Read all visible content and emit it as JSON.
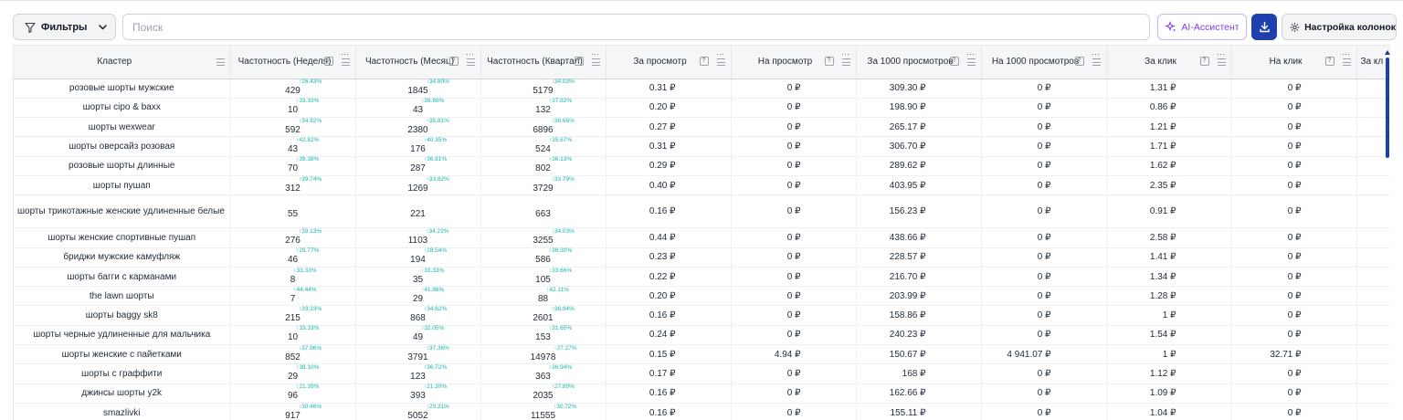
{
  "toolbar": {
    "filters_label": "Фильтры",
    "search_placeholder": "Поиск",
    "ai_label": "AI-Ассистент",
    "columns_label": "Настройка колонок"
  },
  "table": {
    "headers": {
      "cluster": "Кластер",
      "freq_week": "Частотность (Неделя)",
      "freq_month": "Частотность (Месяц)",
      "freq_quarter": "Частотность (Квартал)",
      "per_view": "За просмотр",
      "on_view": "На просмотр",
      "per_1000": "За 1000 просмотров",
      "on_1000": "На 1000 просмотров",
      "per_click": "За клик",
      "on_click": "На клик",
      "per_extra": "За кл"
    },
    "rows": [
      {
        "kw": "розовые шорты мужские",
        "w": "429",
        "wp": "↑26.43%",
        "m": "1845",
        "mp": "↑34.80%",
        "q": "5179",
        "qp": "↑34.03%",
        "pv": "0.31 ₽",
        "ov": "0 ₽",
        "p1k": "309.30 ₽",
        "o1k": "0 ₽",
        "pc": "1.31 ₽",
        "oc": "0 ₽"
      },
      {
        "kw": "шорты cipo & baxx",
        "w": "10",
        "wp": "↑33.33%",
        "m": "43",
        "mp": "↑39.88%",
        "q": "132",
        "qp": "↑37.82%",
        "pv": "0.20 ₽",
        "ov": "0 ₽",
        "p1k": "198.90 ₽",
        "o1k": "0 ₽",
        "pc": "0.86 ₽",
        "oc": "0 ₽"
      },
      {
        "kw": "шорты wexwear",
        "w": "592",
        "wp": "↑34.92%",
        "m": "2380",
        "mp": "↑35.81%",
        "q": "6896",
        "qp": "↑36.65%",
        "pv": "0.27 ₽",
        "ov": "0 ₽",
        "p1k": "265.17 ₽",
        "o1k": "0 ₽",
        "pc": "1.21 ₽",
        "oc": "0 ₽"
      },
      {
        "kw": "шорты оверсайз розовая",
        "w": "43",
        "wp": "↑42.82%",
        "m": "176",
        "mp": "↑40.35%",
        "q": "524",
        "qp": "↑35.67%",
        "pv": "0.31 ₽",
        "ov": "0 ₽",
        "p1k": "306.70 ₽",
        "o1k": "0 ₽",
        "pc": "1.71 ₽",
        "oc": "0 ₽"
      },
      {
        "kw": "розовые шорты длинные",
        "w": "70",
        "wp": "↑39.38%",
        "m": "287",
        "mp": "↑36.81%",
        "q": "802",
        "qp": "↑36.13%",
        "pv": "0.29 ₽",
        "ov": "0 ₽",
        "p1k": "289.62 ₽",
        "o1k": "0 ₽",
        "pc": "1.62 ₽",
        "oc": "0 ₽"
      },
      {
        "kw": "шорты пушап",
        "w": "312",
        "wp": "↑39.74%",
        "m": "1269",
        "mp": "↑33.82%",
        "q": "3729",
        "qp": "↑33.79%",
        "pv": "0.40 ₽",
        "ov": "0 ₽",
        "p1k": "403.95 ₽",
        "o1k": "0 ₽",
        "pc": "2.35 ₽",
        "oc": "0 ₽"
      },
      {
        "kw": "шорты трикотажные женские удлиненные белые",
        "w": "55",
        "wp": "",
        "m": "221",
        "mp": "",
        "q": "663",
        "qp": "",
        "pv": "0.16 ₽",
        "ov": "0 ₽",
        "p1k": "156.23 ₽",
        "o1k": "0 ₽",
        "pc": "0.91 ₽",
        "oc": "0 ₽",
        "tall": true
      },
      {
        "kw": "шорты женские спортивные пушап",
        "w": "276",
        "wp": "↑39.13%",
        "m": "1103",
        "mp": "↑34.23%",
        "q": "3255",
        "qp": "↑34.03%",
        "pv": "0.44 ₽",
        "ov": "0 ₽",
        "p1k": "438.66 ₽",
        "o1k": "0 ₽",
        "pc": "2.58 ₽",
        "oc": "0 ₽"
      },
      {
        "kw": "бриджи мужские камуфляж",
        "w": "46",
        "wp": "↑29.77%",
        "m": "194",
        "mp": "↑28.54%",
        "q": "586",
        "qp": "↑36.30%",
        "pv": "0.23 ₽",
        "ov": "0 ₽",
        "p1k": "228.57 ₽",
        "o1k": "0 ₽",
        "pc": "1.41 ₽",
        "oc": "0 ₽"
      },
      {
        "kw": "шорты багги с карманами",
        "w": "8",
        "wp": "↑33.33%",
        "m": "35",
        "mp": "↑33.33%",
        "q": "105",
        "qp": "↑33.66%",
        "pv": "0.22 ₽",
        "ov": "0 ₽",
        "p1k": "216.70 ₽",
        "o1k": "0 ₽",
        "pc": "1.34 ₽",
        "oc": "0 ₽"
      },
      {
        "kw": "the lawn шорты",
        "w": "7",
        "wp": "↑44.44%",
        "m": "29",
        "mp": "↑41.86%",
        "q": "88",
        "qp": "↑42.11%",
        "pv": "0.20 ₽",
        "ov": "0 ₽",
        "p1k": "203.99 ₽",
        "o1k": "0 ₽",
        "pc": "1.28 ₽",
        "oc": "0 ₽"
      },
      {
        "kw": "шорты baggy sk8",
        "w": "215",
        "wp": "↑33.33%",
        "m": "868",
        "mp": "↑34.62%",
        "q": "2601",
        "qp": "↑36.94%",
        "pv": "0.16 ₽",
        "ov": "0 ₽",
        "p1k": "158.86 ₽",
        "o1k": "0 ₽",
        "pc": "1 ₽",
        "oc": "0 ₽"
      },
      {
        "kw": "шорты черные удлиненные для мальчика",
        "w": "10",
        "wp": "↑33.33%",
        "m": "49",
        "mp": "↑32.05%",
        "q": "153",
        "qp": "↑31.65%",
        "pv": "0.24 ₽",
        "ov": "0 ₽",
        "p1k": "240.23 ₽",
        "o1k": "0 ₽",
        "pc": "1.54 ₽",
        "oc": "0 ₽"
      },
      {
        "kw": "шорты женские с пайетками",
        "w": "852",
        "wp": "↑37.96%",
        "m": "3791",
        "mp": "↑37.36%",
        "q": "14978",
        "qp": "↑27.27%",
        "pv": "0.15 ₽",
        "ov": "4.94 ₽",
        "p1k": "150.67 ₽",
        "o1k": "4 941.07 ₽",
        "pc": "1 ₽",
        "oc": "32.71 ₽"
      },
      {
        "kw": "шорты с граффити",
        "w": "29",
        "wp": "↑38.10%",
        "m": "123",
        "mp": "↑36.72%",
        "q": "363",
        "qp": "↑36.94%",
        "pv": "0.17 ₽",
        "ov": "0 ₽",
        "p1k": "168 ₽",
        "o1k": "0 ₽",
        "pc": "1.12 ₽",
        "oc": "0 ₽"
      },
      {
        "kw": "джинсы шорты y2k",
        "w": "96",
        "wp": "↑21.39%",
        "m": "393",
        "mp": "↑21.30%",
        "q": "2035",
        "qp": "↑27.89%",
        "pv": "0.16 ₽",
        "ov": "0 ₽",
        "p1k": "162.66 ₽",
        "o1k": "0 ₽",
        "pc": "1.09 ₽",
        "oc": "0 ₽"
      },
      {
        "kw": "smazlivki",
        "w": "917",
        "wp": "↑30.46%",
        "m": "5052",
        "mp": "↑20.31%",
        "q": "11555",
        "qp": "↑30.72%",
        "pv": "0.16 ₽",
        "ov": "0 ₽",
        "p1k": "155.11 ₽",
        "o1k": "0 ₽",
        "pc": "1.04 ₽",
        "oc": "0 ₽"
      }
    ]
  },
  "colors": {
    "accent": "#1e40af",
    "ai": "#7c3aed",
    "growth": "#14b8a6"
  }
}
